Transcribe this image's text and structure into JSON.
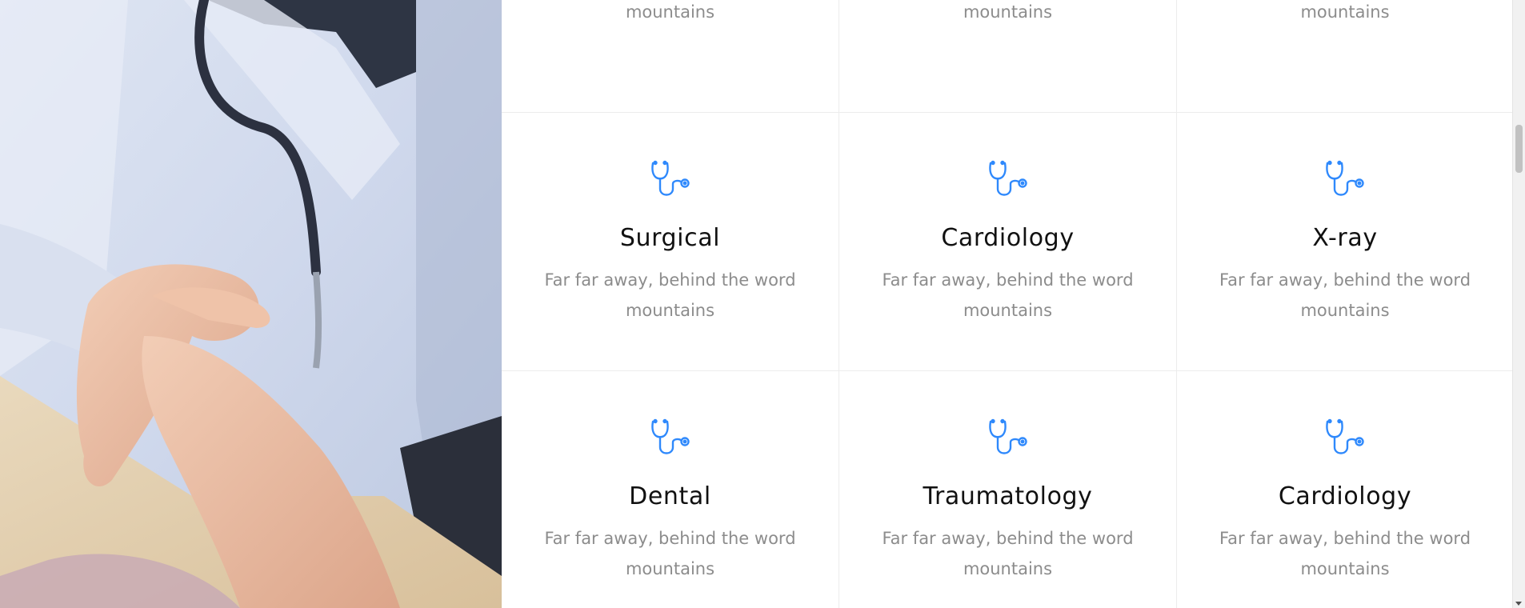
{
  "services": [
    {
      "title": "",
      "desc": "Far far away, behind the word mountains",
      "icon": "stethoscope-icon"
    },
    {
      "title": "",
      "desc": "Far far away, behind the word mountains",
      "icon": "stethoscope-icon"
    },
    {
      "title": "",
      "desc": "Far far away, behind the word mountains",
      "icon": "stethoscope-icon"
    },
    {
      "title": "Surgical",
      "desc": "Far far away, behind the word mountains",
      "icon": "stethoscope-icon"
    },
    {
      "title": "Cardiology",
      "desc": "Far far away, behind the word mountains",
      "icon": "stethoscope-icon"
    },
    {
      "title": "X-ray",
      "desc": "Far far away, behind the word mountains",
      "icon": "stethoscope-icon"
    },
    {
      "title": "Dental",
      "desc": "Far far away, behind the word mountains",
      "icon": "stethoscope-icon"
    },
    {
      "title": "Traumatology",
      "desc": "Far far away, behind the word mountains",
      "icon": "stethoscope-icon"
    },
    {
      "title": "Cardiology",
      "desc": "Far far away, behind the word mountains",
      "icon": "stethoscope-icon"
    }
  ],
  "colors": {
    "accent": "#2f89fc",
    "title": "#111111",
    "text": "#8c8c8c",
    "border": "#ececec"
  }
}
